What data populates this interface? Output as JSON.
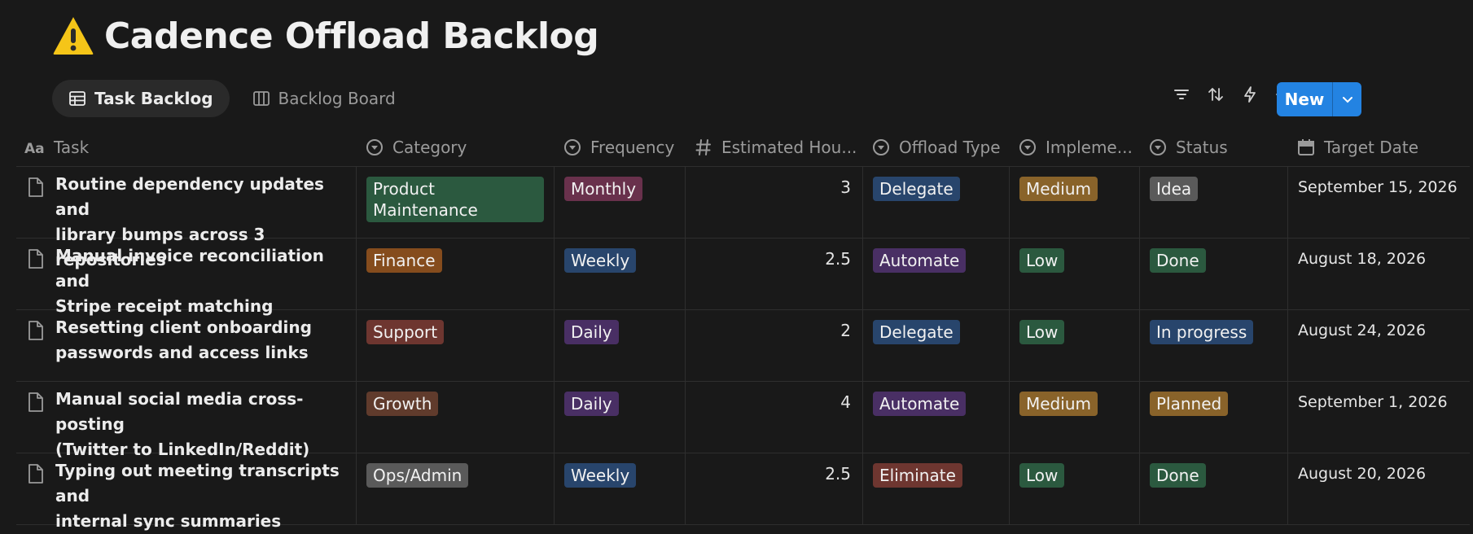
{
  "page": {
    "title": "Cadence Offload Backlog"
  },
  "views": [
    {
      "label": "Task Backlog",
      "icon": "table-icon",
      "active": true
    },
    {
      "label": "Backlog Board",
      "icon": "board-icon",
      "active": false
    }
  ],
  "toolbar": {
    "icons": [
      "filter-icon",
      "sort-icon",
      "automation-icon",
      "ai-sparkle-icon",
      "search-icon",
      "settings-sliders-icon"
    ],
    "new_label": "New"
  },
  "columns": [
    {
      "label": "Task",
      "icon": "text-type-icon"
    },
    {
      "label": "Category",
      "icon": "select-icon"
    },
    {
      "label": "Frequency",
      "icon": "select-icon"
    },
    {
      "label": "Estimated Hou...",
      "icon": "number-icon"
    },
    {
      "label": "Offload Type",
      "icon": "select-icon"
    },
    {
      "label": "Impleme...",
      "icon": "select-icon"
    },
    {
      "label": "Status",
      "icon": "select-icon"
    },
    {
      "label": "Target Date",
      "icon": "calendar-icon"
    }
  ],
  "colors": {
    "green": "#2b593f",
    "pink": "#69314c",
    "blue": "#28456c",
    "yellow": "#89632a",
    "gray": "#5a5a5a",
    "orange": "#854c1d",
    "purple": "#492f64",
    "red": "#6e3630",
    "brown": "#603b2c"
  },
  "rows": [
    {
      "task_line1": "Routine dependency updates and",
      "task_line2": "library bumps across 3 repositories",
      "category": "Product Maintenance",
      "category_color": "#2b593f",
      "frequency": "Monthly",
      "frequency_color": "#69314c",
      "hours": "3",
      "offload": "Delegate",
      "offload_color": "#28456c",
      "impl": "Medium",
      "impl_color": "#89632a",
      "status": "Idea",
      "status_color": "#5a5a5a",
      "date": "September 15, 2026"
    },
    {
      "task_line1": "Manual invoice reconciliation and",
      "task_line2": "Stripe receipt matching",
      "category": "Finance",
      "category_color": "#854c1d",
      "frequency": "Weekly",
      "frequency_color": "#28456c",
      "hours": "2.5",
      "offload": "Automate",
      "offload_color": "#492f64",
      "impl": "Low",
      "impl_color": "#2b593f",
      "status": "Done",
      "status_color": "#2b593f",
      "date": "August 18, 2026"
    },
    {
      "task_line1": "Resetting client onboarding",
      "task_line2": "passwords and access links",
      "category": "Support",
      "category_color": "#6e3630",
      "frequency": "Daily",
      "frequency_color": "#492f64",
      "hours": "2",
      "offload": "Delegate",
      "offload_color": "#28456c",
      "impl": "Low",
      "impl_color": "#2b593f",
      "status": "In progress",
      "status_color": "#28456c",
      "date": "August 24, 2026"
    },
    {
      "task_line1": "Manual social media cross-posting",
      "task_line2": "(Twitter to LinkedIn/Reddit)",
      "category": "Growth",
      "category_color": "#603b2c",
      "frequency": "Daily",
      "frequency_color": "#492f64",
      "hours": "4",
      "offload": "Automate",
      "offload_color": "#492f64",
      "impl": "Medium",
      "impl_color": "#89632a",
      "status": "Planned",
      "status_color": "#89632a",
      "date": "September 1, 2026"
    },
    {
      "task_line1": "Typing out meeting transcripts and",
      "task_line2": "internal sync summaries",
      "category": "Ops/Admin",
      "category_color": "#5a5a5a",
      "frequency": "Weekly",
      "frequency_color": "#28456c",
      "hours": "2.5",
      "offload": "Eliminate",
      "offload_color": "#6e3630",
      "impl": "Low",
      "impl_color": "#2b593f",
      "status": "Done",
      "status_color": "#2b593f",
      "date": "August 20, 2026"
    }
  ]
}
